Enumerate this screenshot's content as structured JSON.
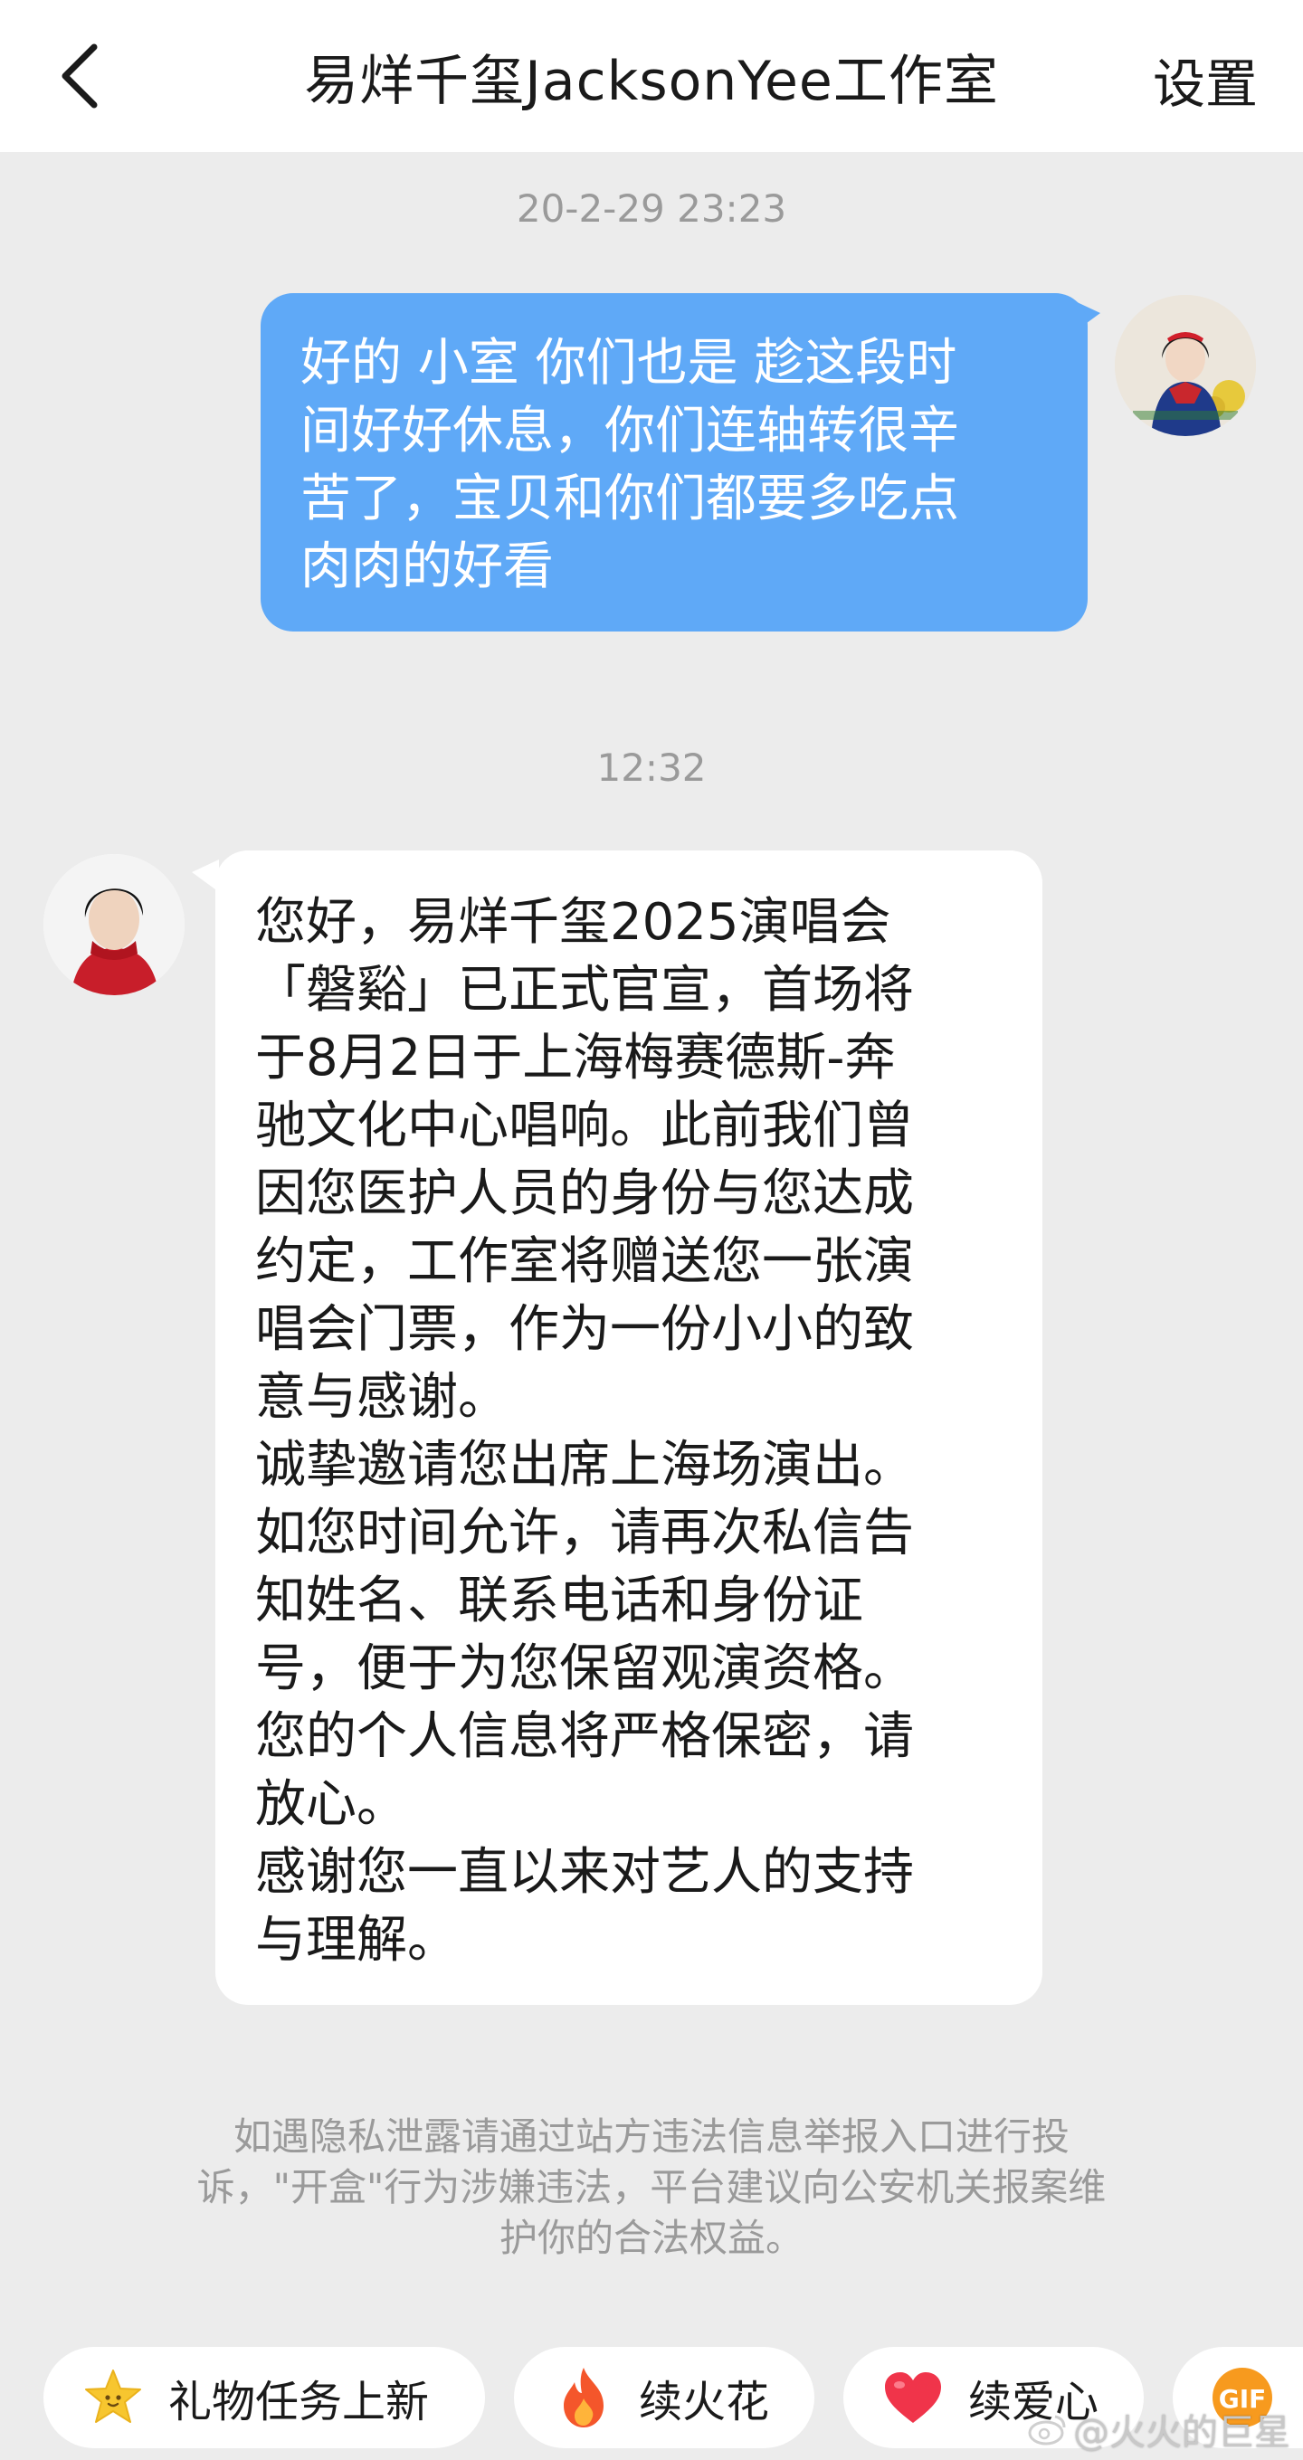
{
  "header": {
    "back_icon": "chevron-left-icon",
    "title": "易烊千玺JacksonYee工作室",
    "settings_label": "设置"
  },
  "conversation": {
    "timestamp_1": "20-2-29 23:23",
    "outgoing_message": {
      "lines": [
        "好的 小室 你们也是 趁这段时",
        "间好好休息，你们连轴转很辛",
        "苦了，宝贝和你们都要多吃点",
        "肉肉的好看"
      ],
      "avatar": "user-avatar",
      "bubble_color": "#5fa9f7"
    },
    "timestamp_2": "12:32",
    "incoming_message": {
      "lines": [
        "您好，易烊千玺2025演唱会",
        "「磐谿」已正式官宣，首场将",
        "于8月2日于上海梅赛德斯-奔",
        "驰文化中心唱响。此前我们曾",
        "因您医护人员的身份与您达成",
        "约定，工作室将赠送您一张演",
        "唱会门票，作为一份小小的致",
        "意与感谢。",
        "诚挚邀请您出席上海场演出。",
        "如您时间允许，请再次私信告",
        "知姓名、联系电话和身份证",
        "号，便于为您保留观演资格。",
        "您的个人信息将严格保密，请",
        "放心。",
        "感谢您一直以来对艺人的支持",
        "与理解。"
      ],
      "avatar": "studio-avatar",
      "bubble_color": "#ffffff"
    }
  },
  "privacy_notice": {
    "lines": [
      "如遇隐私泄露请通过站方违法信息举报入口进行投",
      "诉，\"开盒\"行为涉嫌违法，平台建议向公安机关报案维",
      "护你的合法权益。"
    ]
  },
  "quick_actions": [
    {
      "label": "礼物任务上新",
      "icon": "star-face-icon"
    },
    {
      "label": "续火花",
      "icon": "flame-icon"
    },
    {
      "label": "续爱心",
      "icon": "heart-icon"
    },
    {
      "label": "GIF",
      "icon": "gif-icon"
    }
  ],
  "watermark": "@火火的巨星",
  "colors": {
    "background": "#ececec",
    "header": "#ffffff",
    "timestamp": "#9a9a9a",
    "outgoing_bubble": "#5fa9f7"
  }
}
